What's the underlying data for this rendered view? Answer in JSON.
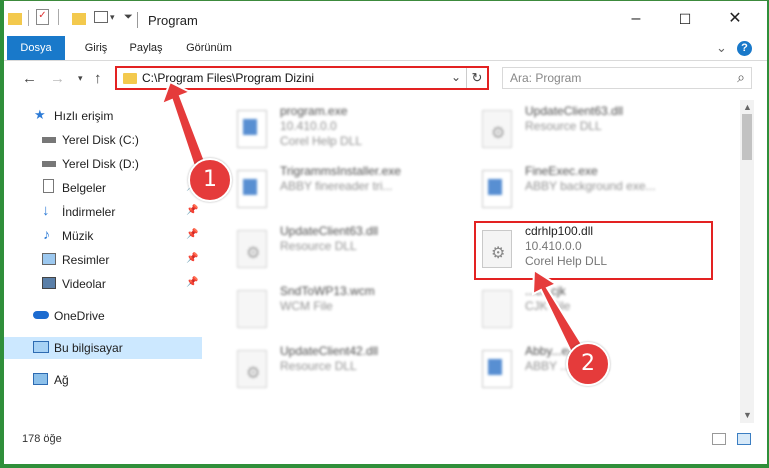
{
  "window": {
    "title": "Program"
  },
  "ribbon": {
    "tabs": [
      "Dosya",
      "Giriş",
      "Paylaş",
      "Görünüm"
    ],
    "help": "?"
  },
  "nav": {
    "address": "C:\\Program Files\\Program Dizini",
    "search_placeholder": "Ara: Program"
  },
  "sidebar": {
    "items": [
      {
        "label": "Hızlı erişim",
        "icon": "star-icon"
      },
      {
        "label": "Yerel Disk (C:)",
        "icon": "drive-icon"
      },
      {
        "label": "Yerel Disk (D:)",
        "icon": "drive-icon"
      },
      {
        "label": "Belgeler",
        "icon": "documents-icon"
      },
      {
        "label": "İndirmeler",
        "icon": "download-icon"
      },
      {
        "label": "Müzik",
        "icon": "music-icon"
      },
      {
        "label": "Resimler",
        "icon": "pictures-icon"
      },
      {
        "label": "Videolar",
        "icon": "videos-icon"
      },
      {
        "label": "OneDrive",
        "icon": "cloud-icon"
      },
      {
        "label": "Bu bilgisayar",
        "icon": "computer-icon"
      },
      {
        "label": "Ağ",
        "icon": "network-icon"
      }
    ]
  },
  "files": [
    {
      "name": "program.exe",
      "l2": "10.410.0.0",
      "l3": "Corel Help DLL",
      "type": "exe"
    },
    {
      "name": "UpdateClient63.dll",
      "l2": "Resource DLL",
      "l3": "",
      "type": "dll"
    },
    {
      "name": "TrigrammsInstaller.exe",
      "l2": "ABBY finereader tri...",
      "l3": "",
      "type": "exe"
    },
    {
      "name": "FineExec.exe",
      "l2": "ABBY background exe...",
      "l3": "",
      "type": "exe"
    },
    {
      "name": "UpdateClient63.dll",
      "l2": "Resource DLL",
      "l3": "",
      "type": "dll"
    },
    {
      "name": "cdrhlp100.dll",
      "l2": "10.410.0.0",
      "l3": "Corel Help DLL",
      "type": "dll"
    },
    {
      "name": "SndToWP13.wcm",
      "l2": "WCM File",
      "l3": "",
      "type": "doc"
    },
    {
      "name": "...cn.cjk",
      "l2": "CJK File",
      "l3": "",
      "type": "doc"
    },
    {
      "name": "UpdateClient42.dll",
      "l2": "Resource DLL",
      "l3": "",
      "type": "dll"
    },
    {
      "name": "Abby...exe",
      "l2": "ABBY ... hand...",
      "l3": "",
      "type": "exe"
    }
  ],
  "status": {
    "count": "178 öğe"
  },
  "annotations": {
    "step1": "1",
    "step2": "2"
  },
  "colors": {
    "accent": "#1979ca",
    "highlight": "#e32222",
    "selection": "#cce8ff"
  }
}
